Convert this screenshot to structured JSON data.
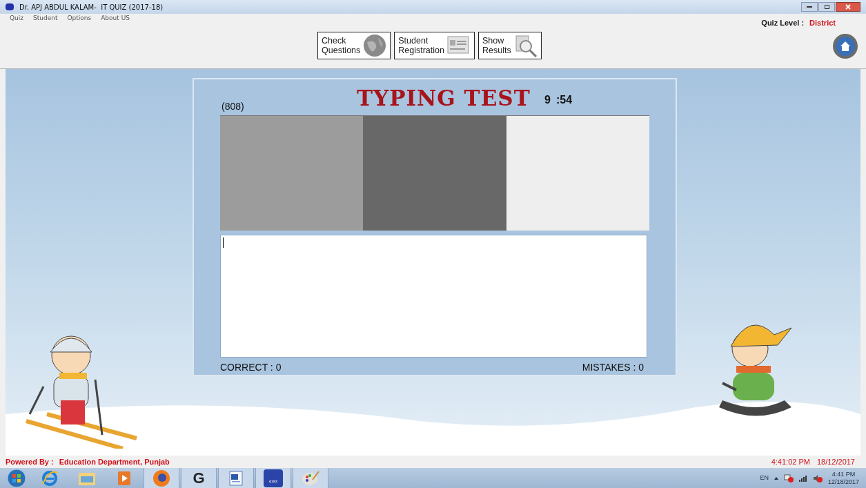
{
  "window": {
    "title": "Dr. APJ ABDUL KALAM-  IT QUIZ (2017-18)"
  },
  "menu": [
    "Quiz",
    "Student",
    "Options",
    "About US"
  ],
  "quiz_level": {
    "label": "Quiz Level :",
    "value": "District"
  },
  "toolbar": [
    {
      "lines": [
        "Check",
        "Questions"
      ],
      "kind": "globe"
    },
    {
      "lines": [
        "Student",
        "Registration"
      ],
      "kind": "form"
    },
    {
      "lines": [
        "Show",
        "Results"
      ],
      "kind": "magnifier"
    }
  ],
  "test": {
    "count": "(808)",
    "title": "TYPING TEST",
    "timer_minutes": "9",
    "timer_seconds": ":54",
    "correct": "CORRECT : 0",
    "mistakes": "MISTAKES : 0"
  },
  "status_bar": {
    "label": "Powered By :",
    "org": "Education Department, Punjab",
    "time": "4:41:02 PM",
    "date": "18/12/2017"
  },
  "taskbar": {
    "apps": [
      {
        "kind": "start",
        "running": false
      },
      {
        "kind": "browser",
        "running": false
      },
      {
        "kind": "folder",
        "running": false
      },
      {
        "kind": "media",
        "running": false
      },
      {
        "kind": "fox",
        "running": true
      },
      {
        "kind": "g",
        "label": "G",
        "running": true
      },
      {
        "kind": "word",
        "running": true
      },
      {
        "kind": "quiz",
        "label": "quiz",
        "running": true
      },
      {
        "kind": "paint",
        "running": true
      }
    ],
    "language": "EN",
    "time": "4:41 PM",
    "date": "12/18/2017"
  }
}
